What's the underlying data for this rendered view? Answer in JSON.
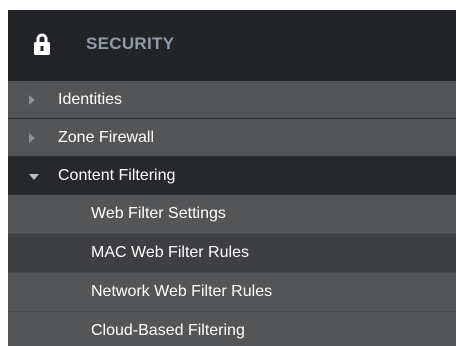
{
  "header": {
    "icon": "lock-icon",
    "title": "SECURITY",
    "title_color": "#8f9ba8"
  },
  "items": [
    {
      "label": "Identities",
      "icon": "chevron-right-icon",
      "expanded": false
    },
    {
      "label": "Zone Firewall",
      "icon": "chevron-right-icon",
      "expanded": false
    },
    {
      "label": "Content Filtering",
      "icon": "chevron-down-icon",
      "expanded": true
    }
  ],
  "subitems": [
    {
      "label": "Web Filter Settings",
      "selected": false
    },
    {
      "label": "MAC Web Filter Rules",
      "selected": true
    },
    {
      "label": "Network Web Filter Rules",
      "selected": false
    },
    {
      "label": "Cloud-Based Filtering",
      "selected": false
    }
  ],
  "colors": {
    "header_bg": "#232427",
    "item_bg": "#545557",
    "active_bg": "#27282b",
    "selected_bg": "#3e3f42",
    "text": "#ffffff"
  }
}
